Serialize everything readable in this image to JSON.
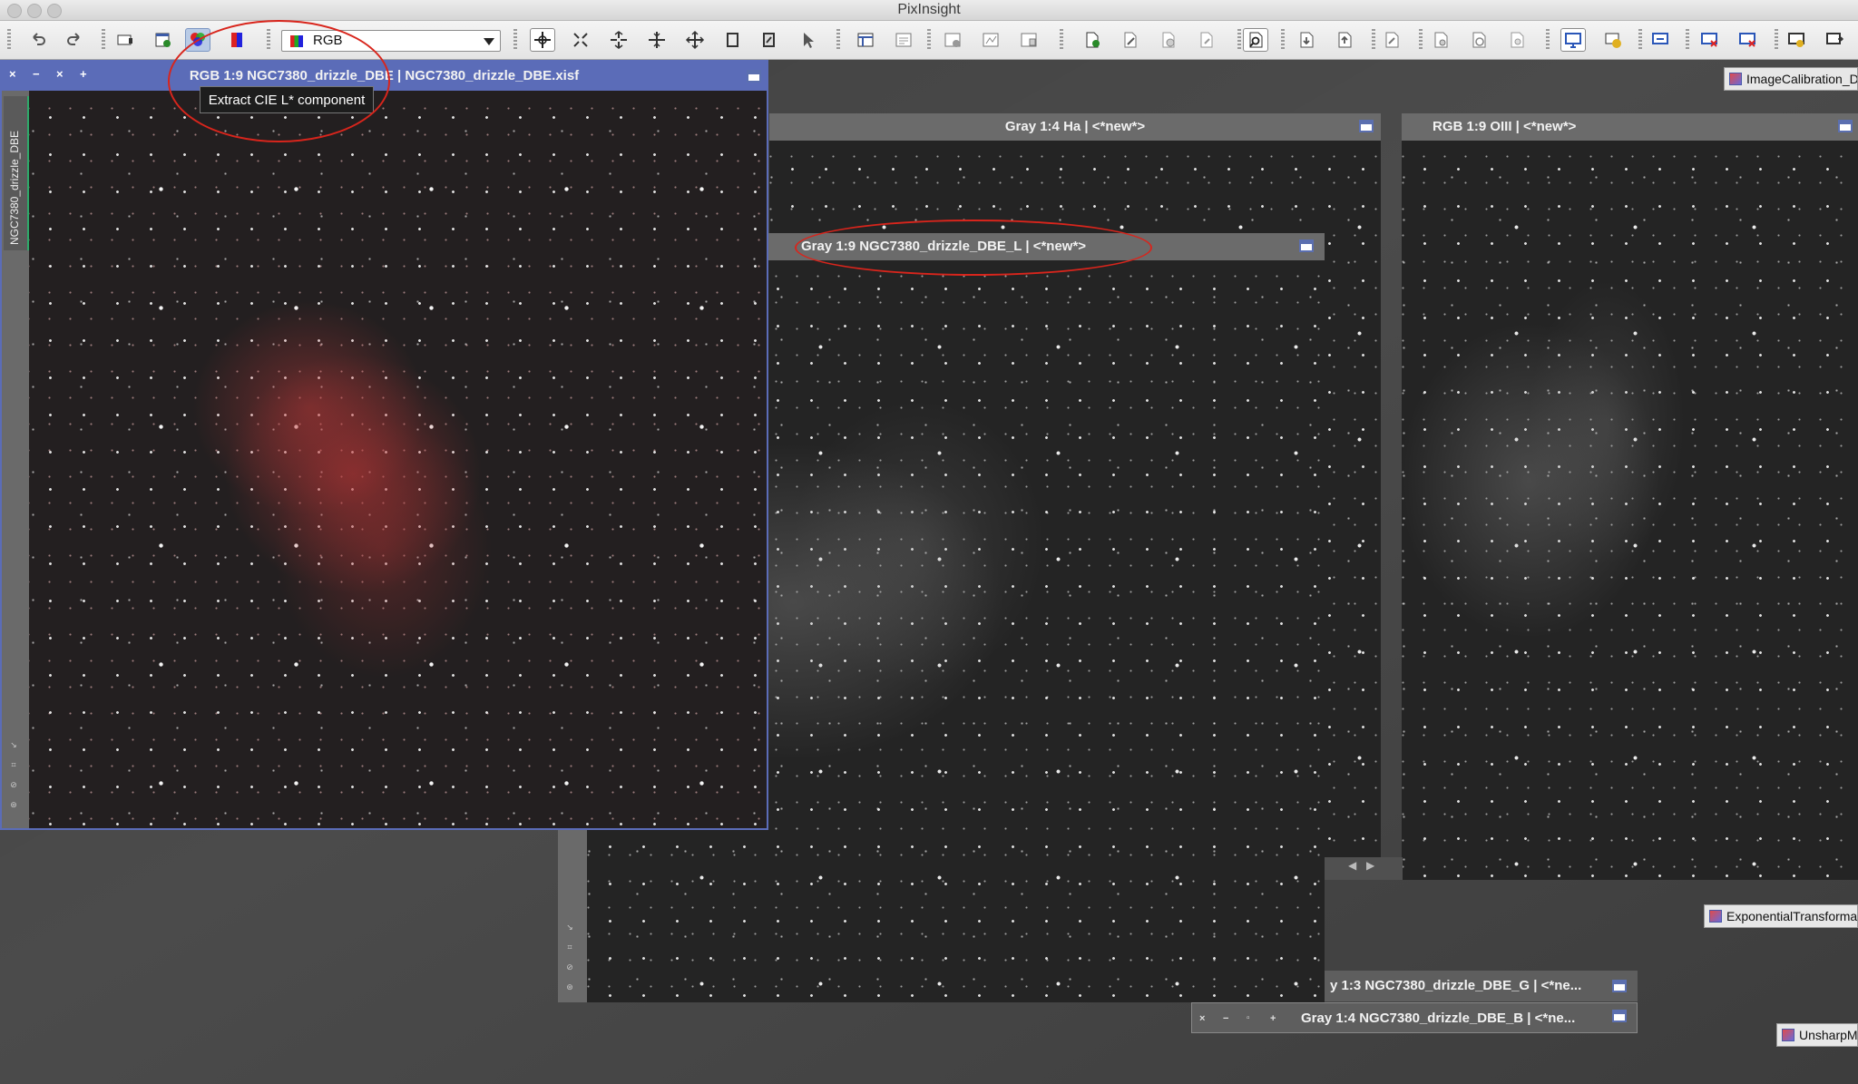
{
  "app": {
    "title": "PixInsight"
  },
  "toolbar": {
    "channel_select_value": "RGB",
    "tooltip": "Extract CIE L* component"
  },
  "windows": {
    "main": {
      "title": "RGB 1:9 NGC7380_drizzle_DBE | NGC7380_drizzle_DBE.xisf",
      "side_tab": "NGC7380_drizzle_DBE"
    },
    "ha": {
      "title": "Gray 1:4 Ha | <*new*>"
    },
    "oiii": {
      "title": "RGB 1:9 OIII | <*new*>"
    },
    "lum": {
      "title": "Gray 1:9 NGC7380_drizzle_DBE_L | <*new*>"
    },
    "g": {
      "title": "y 1:3 NGC7380_drizzle_DBE_G | <*ne..."
    },
    "b": {
      "title": "Gray 1:4 NGC7380_drizzle_DBE_B | <*ne..."
    }
  },
  "process_icons": {
    "image_calibration": "ImageCalibration_DB",
    "exponential": "ExponentialTransformat",
    "unsharp": "UnsharpMa"
  }
}
